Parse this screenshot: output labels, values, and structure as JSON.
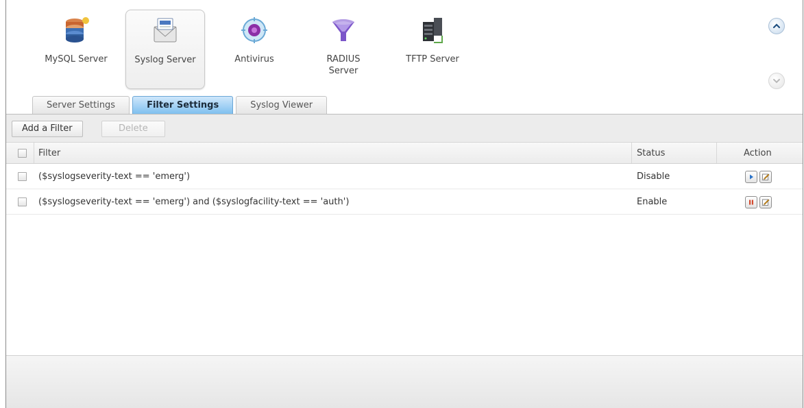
{
  "apps": [
    {
      "label": "MySQL Server",
      "icon": "mysql-database-icon"
    },
    {
      "label": "Syslog Server",
      "icon": "syslog-envelope-icon"
    },
    {
      "label": "Antivirus",
      "icon": "antivirus-icon"
    },
    {
      "label": "RADIUS Server",
      "icon": "radius-funnel-icon"
    },
    {
      "label": "TFTP Server",
      "icon": "tftp-server-icon"
    }
  ],
  "nav": {
    "up_icon": "chevron-up-icon",
    "down_icon": "chevron-down-icon"
  },
  "tabs": [
    {
      "label": "Server Settings"
    },
    {
      "label": "Filter Settings"
    },
    {
      "label": "Syslog Viewer"
    }
  ],
  "toolbar": {
    "add_label": "Add a Filter",
    "delete_label": "Delete"
  },
  "grid": {
    "columns": {
      "filter": "Filter",
      "status": "Status",
      "action": "Action"
    },
    "rows": [
      {
        "filter": "($syslogseverity-text == 'emerg')",
        "status": "Disable",
        "action_primary": "play-icon",
        "action_secondary": "edit-icon"
      },
      {
        "filter": "($syslogseverity-text == 'emerg') and ($syslogfacility-text == 'auth')",
        "status": "Enable",
        "action_primary": "pause-icon",
        "action_secondary": "edit-icon"
      }
    ]
  },
  "colors": {
    "accent": "#7fc0ef",
    "play": "#2a73c9",
    "pause": "#d24a2e"
  }
}
